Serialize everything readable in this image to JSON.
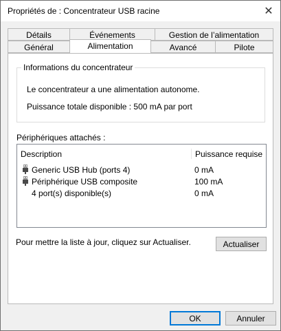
{
  "window": {
    "title": "Propriétés de : Concentrateur USB racine"
  },
  "tabs": {
    "row1": [
      "Détails",
      "Événements",
      "Gestion de l’alimentation"
    ],
    "row2": [
      "Général",
      "Alimentation",
      "Avancé",
      "Pilote"
    ],
    "active": "Alimentation"
  },
  "hub_info": {
    "legend": "Informations du concentrateur",
    "line1": "Le concentrateur a une alimentation autonome.",
    "line2": "Puissance totale disponible : 500 mA par port"
  },
  "devices": {
    "label": "Périphériques attachés :",
    "columns": [
      "Description",
      "Puissance requise"
    ],
    "rows": [
      {
        "description": "Generic USB Hub (ports 4)",
        "power": "0 mA",
        "icon": "usb-plug-icon"
      },
      {
        "description": "Périphérique USB composite",
        "power": "100 mA",
        "icon": "usb-plug-icon"
      },
      {
        "description": "4 port(s) disponible(s)",
        "power": "0 mA",
        "icon": ""
      }
    ]
  },
  "refresh": {
    "hint": "Pour mettre la liste à jour, cliquez sur Actualiser.",
    "button_label": "Actualiser"
  },
  "buttons": {
    "ok": "OK",
    "cancel": "Annuler"
  },
  "colors": {
    "accent": "#0078d7",
    "panel_bg": "#ffffff",
    "window_bg": "#f0f0f0"
  }
}
